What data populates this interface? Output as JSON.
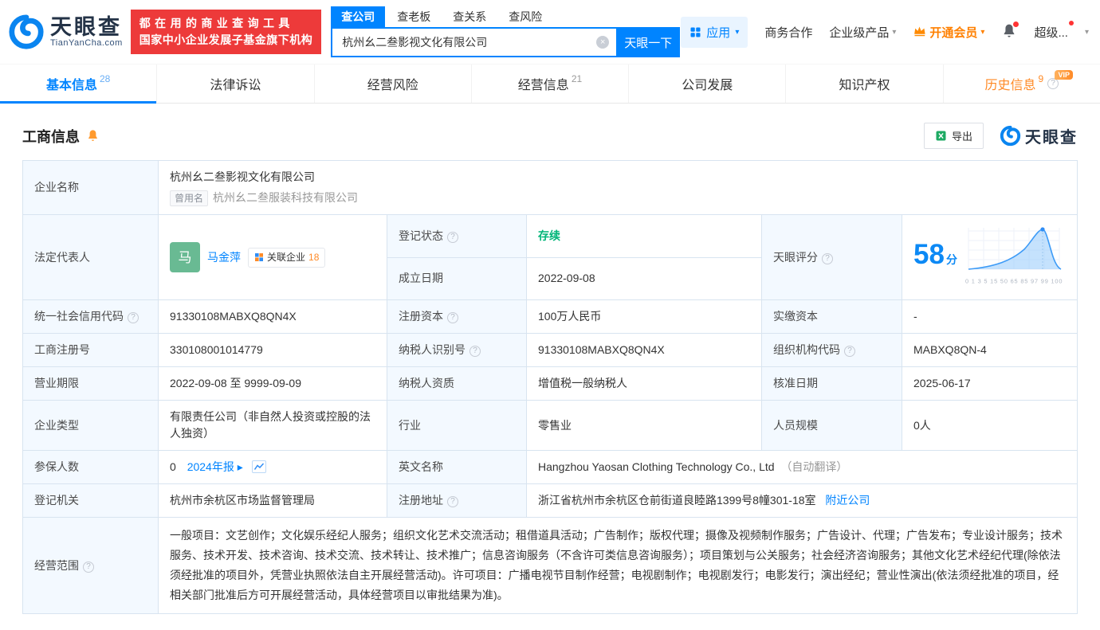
{
  "icons": {
    "caret": "▾",
    "help": "?",
    "clear": "×",
    "arrow_right": " ▸",
    "vip": "VIP"
  },
  "brand": {
    "name": "天眼查",
    "domain": "TianYanCha.com"
  },
  "promo": {
    "line1": "都在用的商业查询工具",
    "line2": "国家中小企业发展子基金旗下机构"
  },
  "search": {
    "tabs": [
      {
        "label": "查公司"
      },
      {
        "label": "查老板"
      },
      {
        "label": "查关系"
      },
      {
        "label": "查风险"
      }
    ],
    "value": "杭州幺二叁影视文化有限公司",
    "button": "天眼一下"
  },
  "topnav": {
    "apps": "应用",
    "cooperation": "商务合作",
    "enterprise": "企业级产品",
    "vip": "开通会员",
    "username": "超级..."
  },
  "tabs": [
    {
      "label": "基本信息",
      "count": "28"
    },
    {
      "label": "法律诉讼",
      "count": ""
    },
    {
      "label": "经营风险",
      "count": ""
    },
    {
      "label": "经营信息",
      "count": "21"
    },
    {
      "label": "公司发展",
      "count": ""
    },
    {
      "label": "知识产权",
      "count": ""
    },
    {
      "label": "历史信息",
      "count": "9"
    }
  ],
  "section": {
    "title": "工商信息",
    "export_label": "导出",
    "logo": "天眼查"
  },
  "company": {
    "name_label": "企业名称",
    "name": "杭州幺二叁影视文化有限公司",
    "former_tag": "曾用名",
    "former_name": "杭州幺二叁服装科技有限公司",
    "legal_rep_label": "法定代表人",
    "legal_rep_avatar": "马",
    "legal_rep": "马金萍",
    "related_label": "关联企业",
    "related_count": "18",
    "status_label": "登记状态",
    "status": "存续",
    "established_label": "成立日期",
    "established": "2022-09-08",
    "score_label": "天眼评分",
    "score": "58",
    "score_unit": "分",
    "score_axis": "0 1 3 5 15 50 65 85 97 99 100",
    "credit_code_label": "统一社会信用代码",
    "credit_code": "91330108MABXQ8QN4X",
    "reg_capital_label": "注册资本",
    "reg_capital": "100万人民币",
    "paid_capital_label": "实缴资本",
    "paid_capital": "-",
    "reg_no_label": "工商注册号",
    "reg_no": "330108001014779",
    "taxpayer_id_label": "纳税人识别号",
    "taxpayer_id": "91330108MABXQ8QN4X",
    "org_code_label": "组织机构代码",
    "org_code": "MABXQ8QN-4",
    "term_label": "营业期限",
    "term": "2022-09-08 至 9999-09-09",
    "taxpayer_quality_label": "纳税人资质",
    "taxpayer_quality": "增值税一般纳税人",
    "approval_date_label": "核准日期",
    "approval_date": "2025-06-17",
    "type_label": "企业类型",
    "type": "有限责任公司（非自然人投资或控股的法人独资）",
    "industry_label": "行业",
    "industry": "零售业",
    "staff_label": "人员规模",
    "staff": "0人",
    "insured_label": "参保人数",
    "insured": "0",
    "annual_report": "2024年报",
    "english_label": "英文名称",
    "english_name": "Hangzhou Yaosan Clothing Technology Co., Ltd",
    "english_note": "（自动翻译）",
    "authority_label": "登记机关",
    "authority": "杭州市余杭区市场监督管理局",
    "address_label": "注册地址",
    "address": "浙江省杭州市余杭区仓前街道良睦路1399号8幢301-18室",
    "nearby": "附近公司",
    "scope_label": "经营范围",
    "scope": "一般项目：文艺创作；文化娱乐经纪人服务；组织文化艺术交流活动；租借道具活动；广告制作；版权代理；摄像及视频制作服务；广告设计、代理；广告发布；专业设计服务；技术服务、技术开发、技术咨询、技术交流、技术转让、技术推广；信息咨询服务（不含许可类信息咨询服务）；项目策划与公关服务；社会经济咨询服务；其他文化艺术经纪代理(除依法须经批准的项目外，凭营业执照依法自主开展经营活动)。许可项目：广播电视节目制作经营；电视剧制作；电视剧发行；电影发行；演出经纪；营业性演出(依法须经批准的项目，经相关部门批准后方可开展经营活动，具体经营项目以审批结果为准)。"
  }
}
